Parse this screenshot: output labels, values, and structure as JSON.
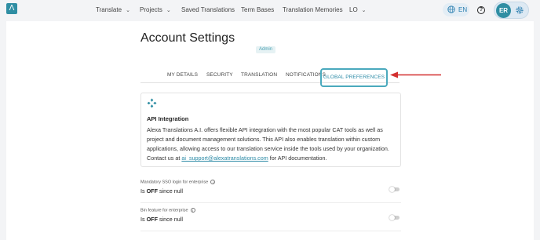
{
  "nav": {
    "logo_glyph": "Λ",
    "items": [
      {
        "label": "Translate",
        "dropdown": true
      },
      {
        "label": "Projects",
        "dropdown": true
      },
      {
        "label": "Saved Translations",
        "dropdown": false
      },
      {
        "label": "Term Bases",
        "dropdown": false
      },
      {
        "label": "Translation Memories",
        "dropdown": false
      },
      {
        "label": "LO",
        "dropdown": true
      }
    ],
    "language": "EN",
    "help_glyph": "?",
    "user_initials": "ER"
  },
  "page": {
    "title": "Account Settings",
    "role_badge": "Admin"
  },
  "tabs": [
    {
      "label": "MY DETAILS",
      "active": false
    },
    {
      "label": "SECURITY",
      "active": false
    },
    {
      "label": "TRANSLATION",
      "active": false
    },
    {
      "label": "NOTIFICATIONS",
      "active": false
    },
    {
      "label": "GLOBAL PREFERENCES",
      "active": true
    }
  ],
  "api_card": {
    "title": "API Integration",
    "body": "Alexa Translations A.I. offers flexible API integration with the most popular CAT tools as well as project and document management solutions. This API also enables translation within custom applications, allowing access to our translation service inside the tools used by your organization.",
    "contact_prefix": "Contact us at ",
    "contact_email": "ai_support@alexatranslations.com",
    "contact_suffix": " for API documentation."
  },
  "settings": [
    {
      "label": "Mandatory SSO login for enterprise",
      "status_prefix": "Is ",
      "status_value": "OFF",
      "status_suffix": " since null",
      "enabled": false
    },
    {
      "label": "Bin feature for enterprise",
      "status_prefix": "Is ",
      "status_value": "OFF",
      "status_suffix": " since null",
      "enabled": false
    }
  ],
  "colors": {
    "accent": "#2f8ea3",
    "tab_highlight": "#4aa9bd",
    "arrow": "#d32f2f"
  }
}
